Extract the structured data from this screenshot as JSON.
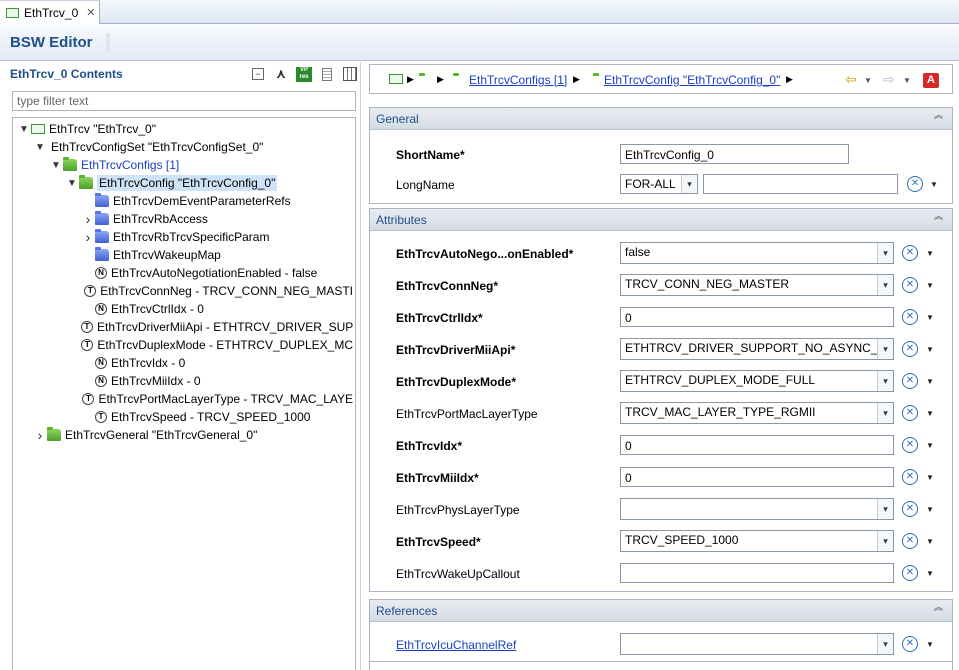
{
  "tab": {
    "title": "EthTrcv_0",
    "close_glyph": "✕"
  },
  "editor": {
    "title": "BSW Editor"
  },
  "left_pane": {
    "title": "EthTrcv_0 Contents",
    "filter_placeholder": "type filter text",
    "tools": [
      "collapse-all-icon",
      "hierarchy-icon",
      "vp-res-icon",
      "document-icon",
      "grid-icon"
    ],
    "vp_label": "VP res",
    "tree": [
      {
        "label": "EthTrcv \"EthTrcv_0\"",
        "icon": "module-icon",
        "depth": 0,
        "expander": "▼"
      },
      {
        "label": "EthTrcvConfigSet \"EthTrcvConfigSet_0\"",
        "icon": "none",
        "depth": 1,
        "expander": "▼"
      },
      {
        "label": "EthTrcvConfigs [1]",
        "icon": "green-folder-icon",
        "depth": 2,
        "expander": "▼",
        "link": true
      },
      {
        "label": "EthTrcvConfig \"EthTrcvConfig_0\"",
        "icon": "green-folder-icon",
        "depth": 3,
        "expander": "▼",
        "selected": true
      },
      {
        "label": "EthTrcvDemEventParameterRefs",
        "icon": "blue-folder-icon",
        "depth": 4,
        "expander": ""
      },
      {
        "label": "EthTrcvRbAccess",
        "icon": "blue-folder-icon",
        "depth": 4,
        "expander": "›"
      },
      {
        "label": "EthTrcvRbTrcvSpecificParam",
        "icon": "blue-folder-icon",
        "depth": 4,
        "expander": "›"
      },
      {
        "label": "EthTrcvWakeupMap",
        "icon": "blue-folder-icon",
        "depth": 4,
        "expander": ""
      },
      {
        "label": "EthTrcvAutoNegotiationEnabled - false",
        "icon": "param-n-icon",
        "glyph": "N",
        "depth": 4,
        "expander": ""
      },
      {
        "label": "EthTrcvConnNeg - TRCV_CONN_NEG_MASTI",
        "icon": "param-t-icon",
        "glyph": "T",
        "depth": 4,
        "expander": ""
      },
      {
        "label": "EthTrcvCtrlIdx - 0",
        "icon": "param-n-icon",
        "glyph": "N",
        "depth": 4,
        "expander": ""
      },
      {
        "label": "EthTrcvDriverMiiApi - ETHTRCV_DRIVER_SUP",
        "icon": "param-t-icon",
        "glyph": "T",
        "depth": 4,
        "expander": ""
      },
      {
        "label": "EthTrcvDuplexMode - ETHTRCV_DUPLEX_MC",
        "icon": "param-t-icon",
        "glyph": "T",
        "depth": 4,
        "expander": ""
      },
      {
        "label": "EthTrcvIdx - 0",
        "icon": "param-n-icon",
        "glyph": "N",
        "depth": 4,
        "expander": ""
      },
      {
        "label": "EthTrcvMiiIdx - 0",
        "icon": "param-n-icon",
        "glyph": "N",
        "depth": 4,
        "expander": ""
      },
      {
        "label": "EthTrcvPortMacLayerType - TRCV_MAC_LAYE",
        "icon": "param-t-icon",
        "glyph": "T",
        "depth": 4,
        "expander": ""
      },
      {
        "label": "EthTrcvSpeed - TRCV_SPEED_1000",
        "icon": "param-t-icon",
        "glyph": "T",
        "depth": 4,
        "expander": ""
      },
      {
        "label": "EthTrcvGeneral \"EthTrcvGeneral_0\"",
        "icon": "green-folder-icon",
        "depth": 1,
        "expander": "›"
      }
    ]
  },
  "breadcrumb": {
    "items": [
      "EthTrcvConfigs [1]",
      "EthTrcvConfig \"EthTrcvConfig_0\""
    ],
    "arrow": "▶",
    "back_glyph": "⇦",
    "forward_glyph": "⇨",
    "dropdown_glyph": "▼",
    "badge": "A"
  },
  "sections": {
    "general": {
      "title": "General",
      "short_name_label": "ShortName*",
      "short_name_value": "EthTrcvConfig_0",
      "long_name_label": "LongName",
      "long_name_lang": "FOR-ALL",
      "long_name_value": ""
    },
    "attributes": {
      "title": "Attributes",
      "fields": [
        {
          "label": "EthTrcvAutoNego...onEnabled*",
          "value": "false",
          "kind": "combo",
          "bold": true
        },
        {
          "label": "EthTrcvConnNeg*",
          "value": "TRCV_CONN_NEG_MASTER",
          "kind": "combo",
          "bold": true
        },
        {
          "label": "EthTrcvCtrlIdx*",
          "value": "0",
          "kind": "text",
          "bold": true
        },
        {
          "label": "EthTrcvDriverMiiApi*",
          "value": "ETHTRCV_DRIVER_SUPPORT_NO_ASYNC_MIICC",
          "kind": "combo",
          "bold": true
        },
        {
          "label": "EthTrcvDuplexMode*",
          "value": "ETHTRCV_DUPLEX_MODE_FULL",
          "kind": "combo",
          "bold": true
        },
        {
          "label": "EthTrcvPortMacLayerType",
          "value": "TRCV_MAC_LAYER_TYPE_RGMII",
          "kind": "combo",
          "bold": false
        },
        {
          "label": "EthTrcvIdx*",
          "value": "0",
          "kind": "text",
          "bold": true
        },
        {
          "label": "EthTrcvMiiIdx*",
          "value": "0",
          "kind": "text",
          "bold": true
        },
        {
          "label": "EthTrcvPhysLayerType",
          "value": "",
          "kind": "combo",
          "bold": false
        },
        {
          "label": "EthTrcvSpeed*",
          "value": "TRCV_SPEED_1000",
          "kind": "combo",
          "bold": true
        },
        {
          "label": "EthTrcvWakeUpCallout",
          "value": "",
          "kind": "text",
          "bold": false
        }
      ]
    },
    "references": {
      "title": "References",
      "fields": [
        {
          "label": "EthTrcvIcuChannelRef",
          "value": "",
          "kind": "combo",
          "link": true
        }
      ]
    }
  },
  "glyphs": {
    "combo_arrow": "▾",
    "action": "✕",
    "action_dd": "▼",
    "collapse": "︽"
  }
}
